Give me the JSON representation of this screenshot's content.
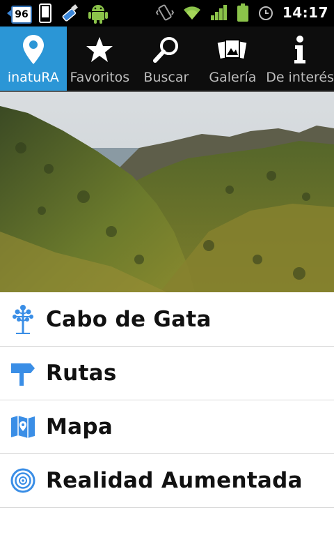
{
  "status_bar": {
    "notification_badge": "96",
    "time": "14:17",
    "left_icons": [
      "notification-badge-icon",
      "phone-icon",
      "usb-icon",
      "android-debug-icon"
    ],
    "right_icons": [
      "vibrate-icon",
      "wifi-icon",
      "signal-icon",
      "battery-icon",
      "alarm-icon"
    ]
  },
  "tabs": [
    {
      "label": "inatuRA",
      "icon": "location-pin-icon",
      "active": true
    },
    {
      "label": "Favoritos",
      "icon": "star-icon",
      "active": false
    },
    {
      "label": "Buscar",
      "icon": "search-icon",
      "active": false
    },
    {
      "label": "Galería",
      "icon": "gallery-icon",
      "active": false
    },
    {
      "label": "De interés",
      "icon": "info-icon",
      "active": false
    }
  ],
  "hero": {
    "alt": "landscape photo of green hills and sea"
  },
  "menu": [
    {
      "label": "Cabo de Gata",
      "icon": "tree-icon"
    },
    {
      "label": "Rutas",
      "icon": "signpost-icon"
    },
    {
      "label": "Mapa",
      "icon": "map-icon"
    },
    {
      "label": "Realidad Aumentada",
      "icon": "radar-icon"
    }
  ],
  "colors": {
    "accent": "#2b96d6",
    "status_bg": "#000000",
    "tabbar_bg": "#0d0d0d",
    "icon_blue": "#3a8ee6"
  }
}
